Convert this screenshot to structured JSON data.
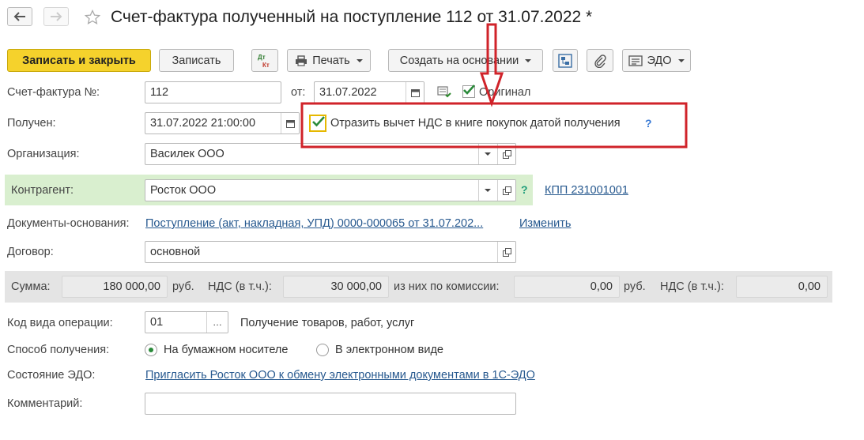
{
  "header": {
    "title": "Счет-фактура полученный на поступление 112 от 31.07.2022 *",
    "back_icon": "arrow-left",
    "forward_icon": "arrow-right",
    "favorite_icon": "star"
  },
  "toolbar": {
    "save_close": "Записать и закрыть",
    "save": "Записать",
    "dt_kt": "Дт Кт",
    "print": "Печать",
    "create_based": "Создать на основании",
    "edo": "ЭДО"
  },
  "form": {
    "invoice_no_label": "Счет-фактура №:",
    "invoice_no": "112",
    "from_label": "от:",
    "from_date": "31.07.2022",
    "original_label": "Оригинал",
    "original_checked": true,
    "received_label": "Получен:",
    "received_value": "31.07.2022 21:00:00",
    "vat_checkbox_label": "Отразить вычет НДС в книге покупок датой получения",
    "vat_checked": true,
    "help": "?",
    "org_label": "Организация:",
    "org_value": "Василек ООО",
    "counterparty_label": "Контрагент:",
    "counterparty_value": "Росток ООО",
    "kpp_link": "КПП 231001001",
    "basis_label": "Документы-основания:",
    "basis_link": "Поступление (акт, накладная, УПД) 0000-000065 от 31.07.202...",
    "change_link": "Изменить",
    "contract_label": "Договор:",
    "contract_value": "основной",
    "op_code_label": "Код вида операции:",
    "op_code_value": "01",
    "op_code_desc": "Получение товаров, работ, услуг",
    "receive_method_label": "Способ получения:",
    "radio_paper": "На бумажном носителе",
    "radio_electronic": "В электронном виде",
    "radio_selected": "paper",
    "edo_state_label": "Состояние ЭДО:",
    "edo_state_link": "Пригласить Росток ООО к обмену электронными документами в 1С-ЭДО",
    "comment_label": "Комментарий:",
    "comment_value": ""
  },
  "sums": {
    "sum_label": "Сумма:",
    "sum_value": "180 000,00",
    "rub1": "руб.",
    "vat_label": "НДС (в т.ч.):",
    "vat_value": "30 000,00",
    "commission_label": "из них по комиссии:",
    "commission_value": "0,00",
    "rub2": "руб.",
    "vat2_label": "НДС (в т.ч.):",
    "vat2_value": "0,00"
  },
  "colors": {
    "primary_button": "#f5d22c",
    "annotation_red": "#d0232a",
    "link": "#27598f",
    "highlight_row": "#d9efcf"
  }
}
